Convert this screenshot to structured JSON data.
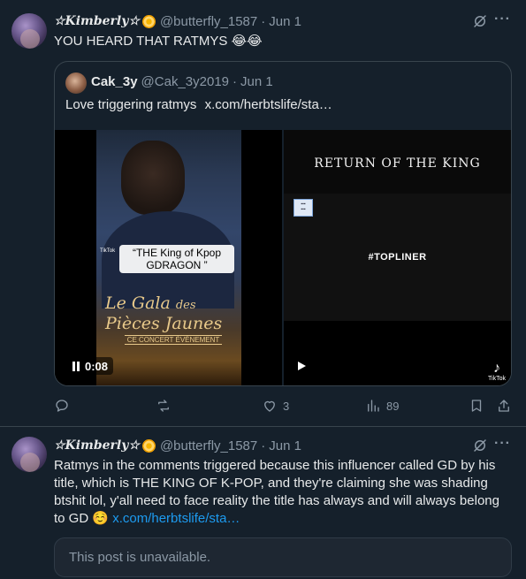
{
  "posts": [
    {
      "display_name": "☆Kimberly☆",
      "handle": "@butterfly_1587",
      "separator": "·",
      "time": "Jun 1",
      "more": "···",
      "text": "YOU HEARD THAT RATMYS 😂😂",
      "quote": {
        "display_name": "Cak_3y",
        "handle": "@Cak_3y2019",
        "separator": "·",
        "time": "Jun 1",
        "text": "Love triggering ratmys",
        "link": "x.com/herbtslife/sta…",
        "media": {
          "left": {
            "caption": "“THE King of Kpop GDRAGON ”",
            "tiktok_small": "TikTok",
            "gala_line1": "Le Gala",
            "gala_line1_small": "des",
            "gala_line2": "Pièces Jaunes",
            "concert_text": "CE CONCERT ÉVÉNEMENT",
            "duration": "0:08"
          },
          "right": {
            "title": "RETURN OF THE KING",
            "hashtag": "#TOPLINER",
            "tiktok_label": "TikTok"
          }
        }
      },
      "actions": {
        "reply": "",
        "repost": "",
        "like": "3",
        "views": "89"
      }
    },
    {
      "display_name": "☆Kimberly☆",
      "handle": "@butterfly_1587",
      "separator": "·",
      "time": "Jun 1",
      "more": "···",
      "text": "Ratmys in the comments triggered because this influencer called GD by his title, which is THE KING OF K-POP, and they're claiming she was shading btshit lol, y'all need to face reality the title has always and will always belong to GD ☺️",
      "link": "x.com/herbtslife/sta…",
      "unavailable": "This post is unavailable."
    }
  ],
  "colors": {
    "background": "#15202b",
    "border": "#38444d",
    "secondary_text": "#8b98a5",
    "link": "#1d9bf0"
  }
}
